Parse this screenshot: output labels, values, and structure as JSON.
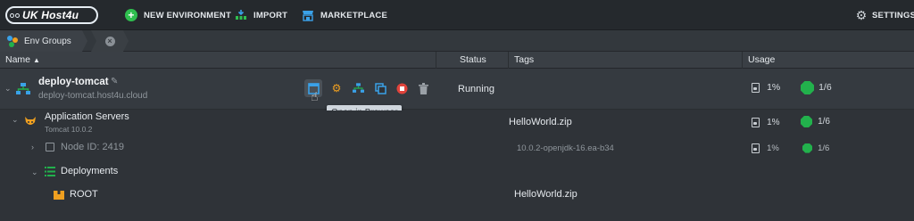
{
  "topbar": {
    "logo": "UK Host4u",
    "new_env": "NEW ENVIRONMENT",
    "import": "IMPORT",
    "marketplace": "MARKETPLACE",
    "settings": "SETTINGS"
  },
  "envbar": {
    "groups": "Env Groups"
  },
  "columns": {
    "name": "Name",
    "status": "Status",
    "tags": "Tags",
    "usage": "Usage"
  },
  "environment": {
    "name": "deploy-tomcat",
    "domain": "deploy-tomcat.host4u.cloud",
    "status": "Running",
    "usage_disk": "1%",
    "usage_cloudlets": "1/6",
    "tooltip": "Open in Browser"
  },
  "app_servers": {
    "label": "Application Servers",
    "sub": "Tomcat 10.0.2",
    "tag": "HelloWorld.zip",
    "usage_disk": "1%",
    "usage_cloudlets": "1/6"
  },
  "node": {
    "label": "Node ID: 2419",
    "tag": "10.0.2-openjdk-16.ea-b34",
    "usage_disk": "1%",
    "usage_cloudlets": "1/6"
  },
  "deployments": {
    "label": "Deployments"
  },
  "root": {
    "label": "ROOT",
    "tag": "HelloWorld.zip"
  },
  "colors": {
    "accent_green": "#22b14c",
    "accent_blue": "#3aa1e8",
    "accent_orange": "#f0a020",
    "stop_red": "#e0433b"
  }
}
